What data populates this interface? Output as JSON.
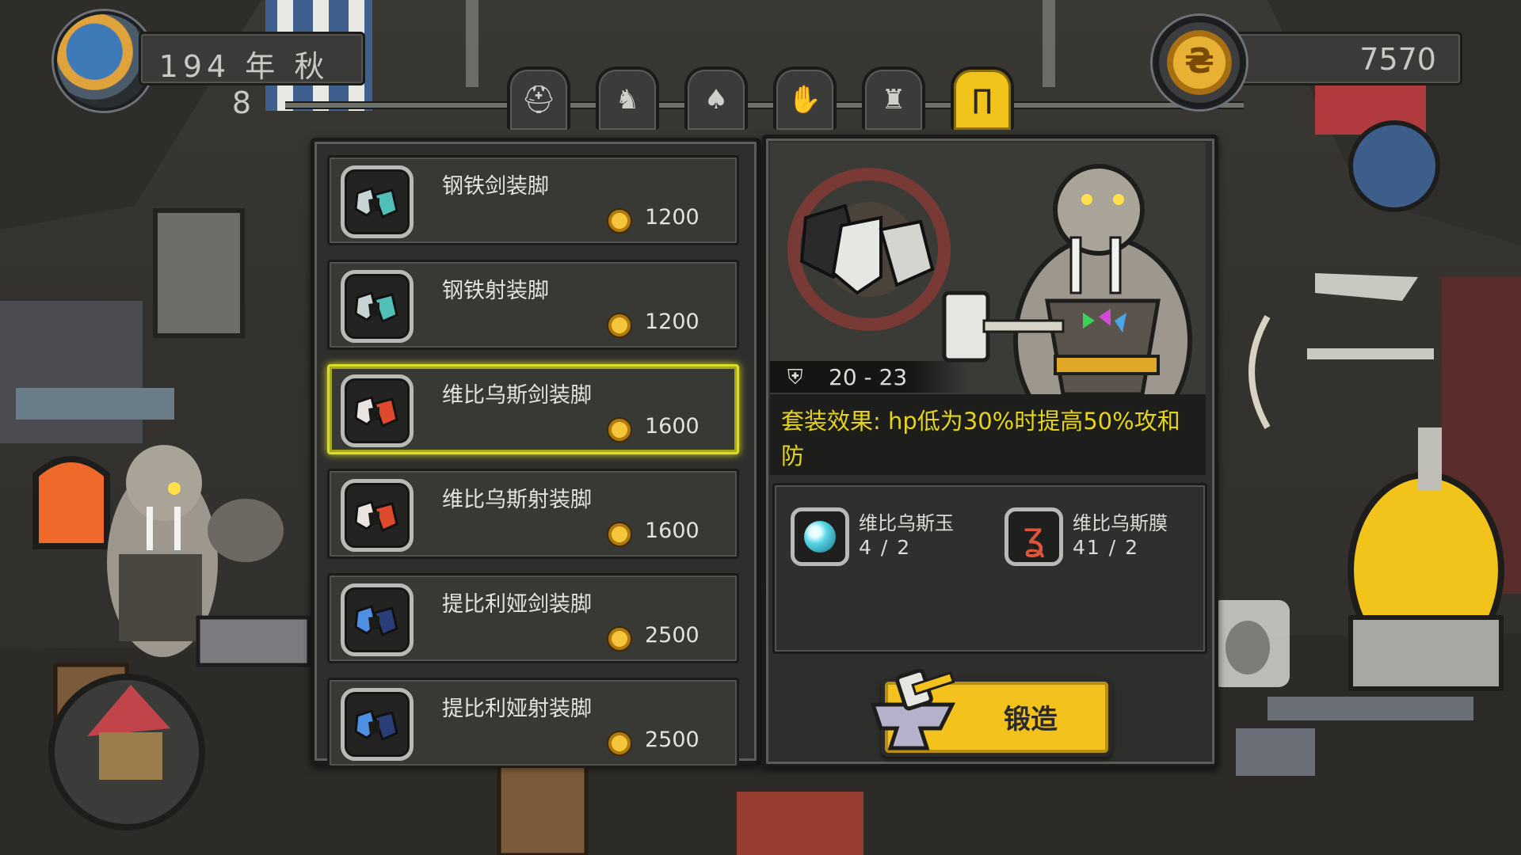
{
  "top_bar": {
    "date": "194 年 秋 8",
    "gold": "7570"
  },
  "tabs": [
    {
      "name": "helmet-tab-icon",
      "glyph": "⛑"
    },
    {
      "name": "boot-shape-tab-icon",
      "glyph": "♞"
    },
    {
      "name": "crest-tab-icon",
      "glyph": "♠"
    },
    {
      "name": "glove-tab-icon",
      "glyph": "✋"
    },
    {
      "name": "chest-armor-tab-icon",
      "glyph": "♜"
    },
    {
      "name": "leg-armor-tab-icon",
      "glyph": "∏",
      "active": true
    }
  ],
  "items": [
    {
      "name": "钢铁剑装脚",
      "price": "1200",
      "colors": [
        "#c8d3d3",
        "#4fbfb8"
      ]
    },
    {
      "name": "钢铁射装脚",
      "price": "1200",
      "colors": [
        "#c8d3d3",
        "#4fbfb8"
      ]
    },
    {
      "name": "维比乌斯剑装脚",
      "price": "1600",
      "colors": [
        "#e9e4e0",
        "#e04a2c"
      ],
      "selected": true
    },
    {
      "name": "维比乌斯射装脚",
      "price": "1600",
      "colors": [
        "#e9e4e0",
        "#e04a2c"
      ]
    },
    {
      "name": "提比利娅剑装脚",
      "price": "2500",
      "colors": [
        "#4d8fe0",
        "#2a3f7a"
      ]
    },
    {
      "name": "提比利娅射装脚",
      "price": "2500",
      "colors": [
        "#4d8fe0",
        "#2a3f7a"
      ]
    }
  ],
  "detail": {
    "stat_range": "20 - 23",
    "set_effect": "套装效果: hp低为30%时提高50%攻和防"
  },
  "materials": [
    {
      "name": "维比乌斯玉",
      "count": "4  / 2",
      "icon": "gem-icon",
      "color": "#55d6e6"
    },
    {
      "name": "维比乌斯膜",
      "count": "41  / 2",
      "icon": "membrane-icon",
      "color": "#e0553a"
    }
  ],
  "forge_button": {
    "label": "锻造"
  },
  "colors": {
    "accent": "#f3c21d",
    "selected_outline": "#d9dc2a",
    "set_effect_text": "#e6d41c"
  }
}
